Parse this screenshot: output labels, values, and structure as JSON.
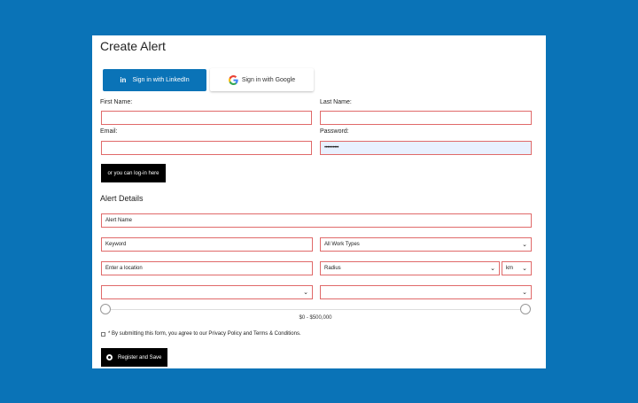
{
  "page": {
    "title": "Create Alert"
  },
  "social": {
    "linkedin_label": "Sign in with LinkedIn",
    "linkedin_glyph": "in",
    "google_label": "Sign in with Google"
  },
  "form": {
    "first_name_label": "First Name:",
    "last_name_label": "Last Name:",
    "email_label": "Email:",
    "password_label": "Password:",
    "first_name_value": "",
    "last_name_value": "",
    "email_value": "",
    "password_value": "••••••••••",
    "login_label": "or you can log-in here"
  },
  "alert": {
    "heading": "Alert Details",
    "alert_name_placeholder": "Alert Name",
    "keyword_placeholder": "Keyword",
    "work_type_selected": "All Work Types",
    "location_placeholder": "Enter a location",
    "radius_selected": "Radius",
    "unit_selected": "km",
    "select_a_selected": "",
    "select_b_selected": "",
    "salary_range": "$0 - $500,000",
    "salary_min_fraction": 0,
    "salary_max_fraction": 1
  },
  "footer": {
    "agree_text": "* By submitting this form, you agree to our Privacy Policy and Terms & Conditions.",
    "register_label": "Register and Save"
  },
  "colors": {
    "background": "#0a73b7",
    "linkedin": "#0a73b7",
    "field_border": "#e06a6a",
    "button_dark": "#000000"
  }
}
